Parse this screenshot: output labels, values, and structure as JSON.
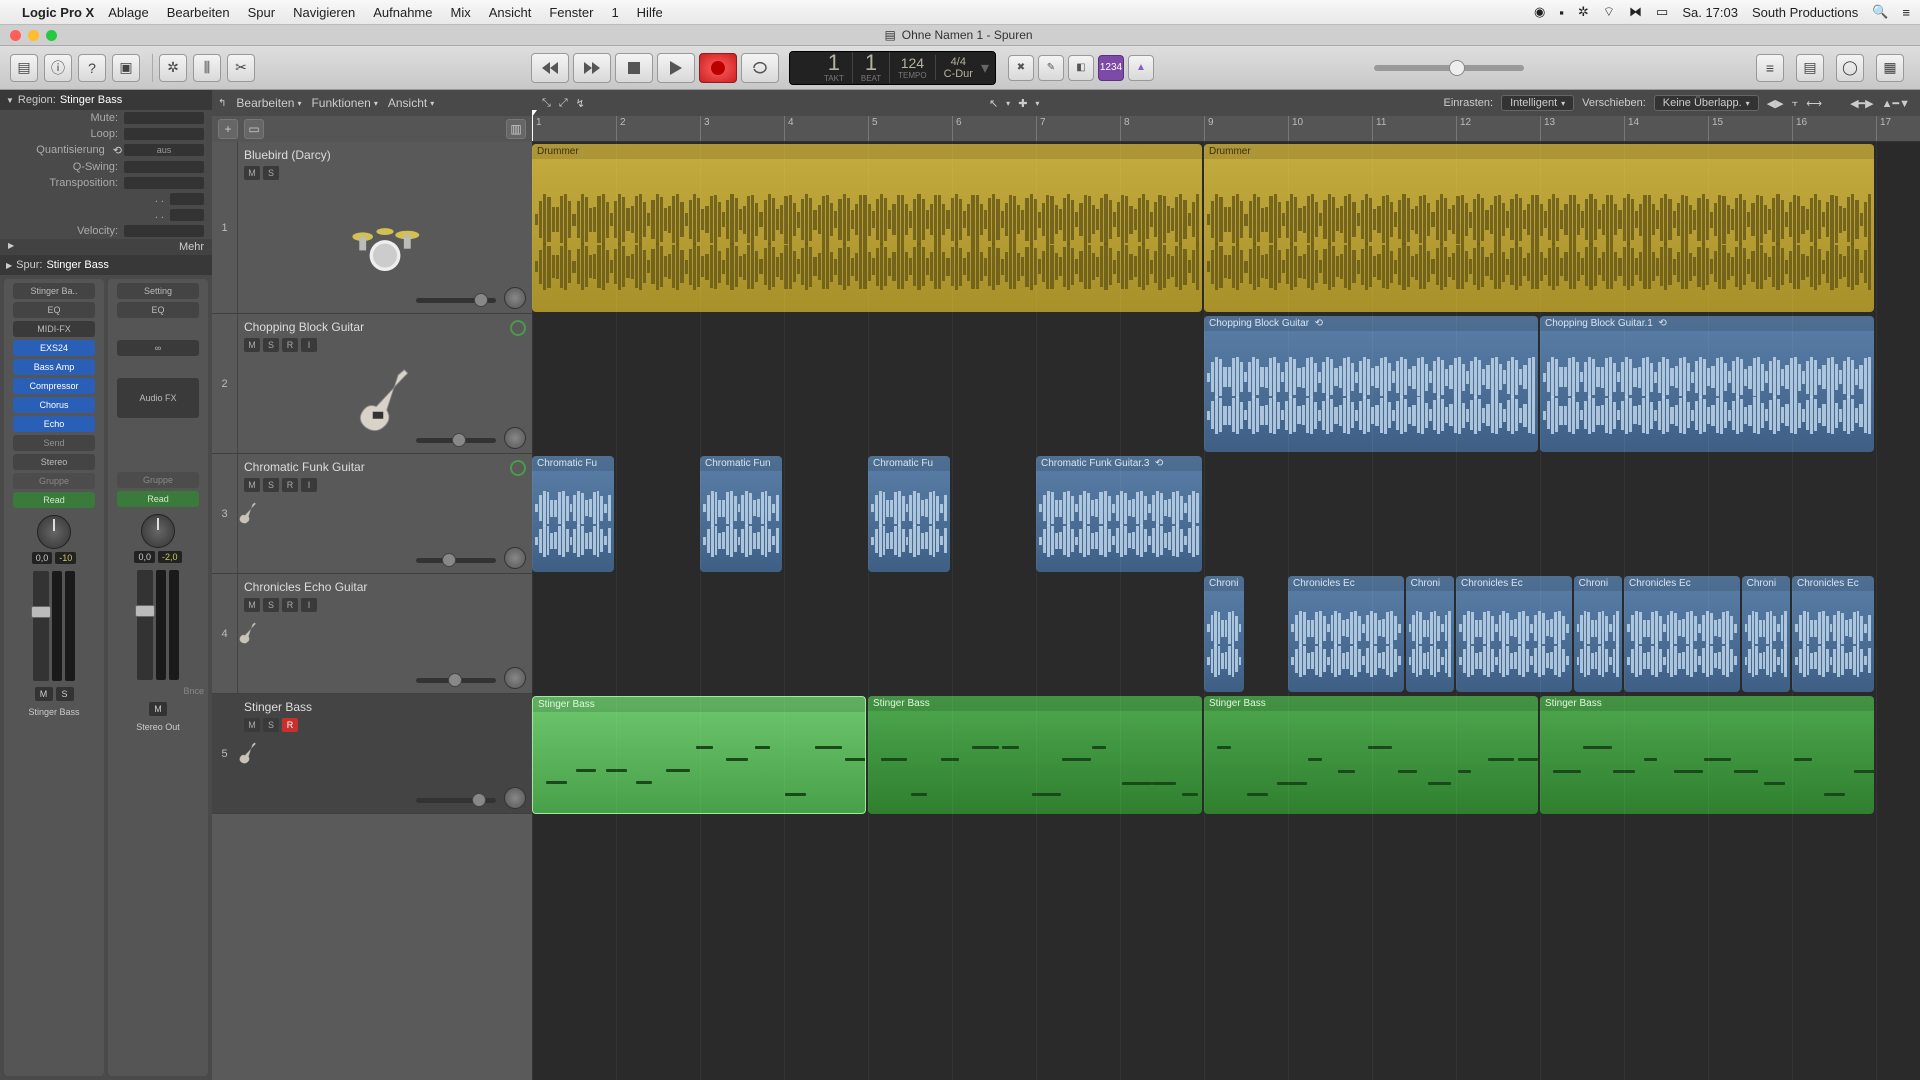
{
  "menubar": {
    "app": "Logic Pro X",
    "items": [
      "Ablage",
      "Bearbeiten",
      "Spur",
      "Navigieren",
      "Aufnahme",
      "Mix",
      "Ansicht",
      "Fenster",
      "1",
      "Hilfe"
    ],
    "clock": "Sa. 17:03",
    "user": "South Productions"
  },
  "window": {
    "title": "Ohne Namen 1 - Spuren"
  },
  "lcd": {
    "bar": "1",
    "beat": "1",
    "tempo": "124",
    "sig": "4/4",
    "key": "C-Dur",
    "lbl_bar": "TAKT",
    "lbl_beat": "BEAT",
    "lbl_tempo": "TEMPO"
  },
  "modebadge": "1234",
  "inspector": {
    "region_label": "Region:",
    "region_name": "Stinger Bass",
    "mute": "Mute:",
    "loop": "Loop:",
    "quant": "Quantisierung",
    "quant_val": "aus",
    "qswing": "Q-Swing:",
    "transp": "Transposition:",
    "vel": "Velocity:",
    "more": "Mehr",
    "track_label": "Spur:",
    "track_name": "Stinger Bass"
  },
  "ch": {
    "left": {
      "name": "Stinger Ba..",
      "setting": "Setting",
      "eq": "EQ",
      "midifx": "MIDI-FX",
      "inst": "EXS24",
      "fx": [
        "Bass Amp",
        "Compressor",
        "Chorus",
        "Echo"
      ],
      "send": "Send",
      "stereo": "Stereo",
      "gruppe": "Gruppe",
      "read": "Read",
      "pan": "0,0",
      "db": "-10",
      "fullname": "Stinger Bass",
      "m": "M",
      "s": "S"
    },
    "right": {
      "name": "Setting",
      "eq": "EQ",
      "link": "∞",
      "audiofx": "Audio FX",
      "gruppe": "Gruppe",
      "read": "Read",
      "pan": "0,0",
      "db": "-2,0",
      "bnce": "Bnce",
      "fullname": "Stereo Out",
      "m": "M"
    }
  },
  "trackmenu": {
    "edit": "Bearbeiten",
    "func": "Funktionen",
    "view": "Ansicht"
  },
  "snap": {
    "label": "Einrasten:",
    "value": "Intelligent",
    "drag_label": "Verschieben:",
    "drag_value": "Keine Überlapp."
  },
  "tracks": [
    {
      "num": "1",
      "name": "Bluebird (Darcy)",
      "btns": [
        "M",
        "S"
      ],
      "icon": "drums",
      "big": true,
      "vol": 72
    },
    {
      "num": "2",
      "name": "Chopping Block Guitar",
      "btns": [
        "M",
        "S",
        "R",
        "I"
      ],
      "icon": "guitar",
      "vol": 45,
      "auto": true
    },
    {
      "num": "3",
      "name": "Chromatic Funk Guitar",
      "btns": [
        "M",
        "S",
        "R",
        "I"
      ],
      "icon": "guitar-sm",
      "vol": 32,
      "auto": true
    },
    {
      "num": "4",
      "name": "Chronicles Echo Guitar",
      "btns": [
        "M",
        "S",
        "R",
        "I"
      ],
      "icon": "guitar-sm",
      "vol": 40
    },
    {
      "num": "5",
      "name": "Stinger Bass",
      "btns": [
        "M",
        "S",
        "R"
      ],
      "icon": "guitar-sm",
      "vol": 70,
      "sel": true,
      "rec": true
    }
  ],
  "ruler": [
    "1",
    "2",
    "3",
    "4",
    "5",
    "6",
    "7",
    "8",
    "9",
    "10",
    "11",
    "12",
    "13",
    "14",
    "15",
    "16",
    "17"
  ],
  "regions": {
    "drummer": [
      {
        "name": "Drummer",
        "start": 0,
        "len": 8
      },
      {
        "name": "Drummer",
        "start": 8,
        "len": 8
      }
    ],
    "chopping": [
      {
        "name": "Chopping Block Guitar",
        "start": 8,
        "len": 4,
        "loop": true
      },
      {
        "name": "Chopping Block Guitar.1",
        "start": 12,
        "len": 4,
        "loop": true
      }
    ],
    "chromatic": [
      {
        "name": "Chromatic Fu",
        "start": 0,
        "len": 1
      },
      {
        "name": "Chromatic Fun",
        "start": 2,
        "len": 1
      },
      {
        "name": "Chromatic Fu",
        "start": 4,
        "len": 1
      },
      {
        "name": "Chromatic Funk Guitar.3",
        "start": 6,
        "len": 2,
        "loop": true
      }
    ],
    "chronicles": [
      {
        "name": "Chroni",
        "start": 8,
        "len": 0.5
      },
      {
        "name": "Chronicles Ec",
        "start": 9,
        "len": 1.4
      },
      {
        "name": "Chroni",
        "start": 10.4,
        "len": 0.6
      },
      {
        "name": "Chronicles Ec",
        "start": 11,
        "len": 1.4
      },
      {
        "name": "Chroni",
        "start": 12.4,
        "len": 0.6
      },
      {
        "name": "Chronicles Ec",
        "start": 13,
        "len": 1.4
      },
      {
        "name": "Chroni",
        "start": 14.4,
        "len": 0.6
      },
      {
        "name": "Chronicles Ec",
        "start": 15,
        "len": 1
      }
    ],
    "bass": [
      {
        "name": "Stinger Bass",
        "start": 0,
        "len": 4,
        "sel": true
      },
      {
        "name": "Stinger Bass",
        "start": 4,
        "len": 4
      },
      {
        "name": "Stinger Bass",
        "start": 8,
        "len": 4
      },
      {
        "name": "Stinger Bass",
        "start": 12,
        "len": 4
      }
    ]
  }
}
